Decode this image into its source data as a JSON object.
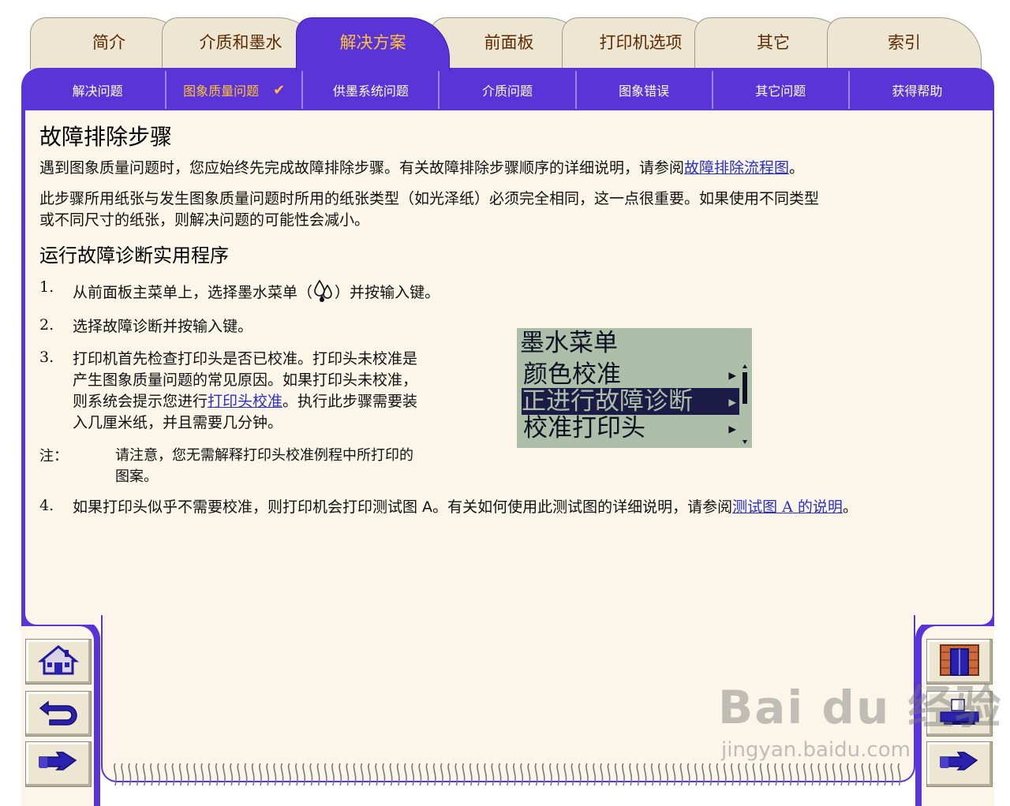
{
  "tabs": [
    {
      "label": "简介",
      "active": false
    },
    {
      "label": "介质和墨水",
      "active": false
    },
    {
      "label": "解决方案",
      "active": true
    },
    {
      "label": "前面板",
      "active": false
    },
    {
      "label": "打印机选项",
      "active": false
    },
    {
      "label": "其它",
      "active": false
    },
    {
      "label": "索引",
      "active": false
    }
  ],
  "subnav": [
    {
      "label": "解决问题",
      "active": false
    },
    {
      "label": "图象质量问题",
      "active": true,
      "check": "✔"
    },
    {
      "label": "供墨系统问题",
      "active": false
    },
    {
      "label": "介质问题",
      "active": false
    },
    {
      "label": "图象错误",
      "active": false
    },
    {
      "label": "其它问题",
      "active": false
    },
    {
      "label": "获得帮助",
      "active": false
    }
  ],
  "content": {
    "title": "故障排除步骤",
    "p1_text": "遇到图象质量问题时，您应始终先完成故障排除步骤。有关故障排除步骤顺序的详细说明，请参阅",
    "p1_link": "故障排除流程图",
    "p1_end": "。",
    "p2_line1": "此步骤所用纸张与发生图象质量问题时所用的纸张类型（如光泽纸）必须完全相同，这一点很重要。如果使用不同类型",
    "p2_line2": "或不同尺寸的纸张，则解决问题的可能性会减小。",
    "h2": "运行故障诊断实用程序",
    "step1": {
      "num": "1.",
      "a": "从前面板主菜单上，选择",
      "b": "墨水菜单",
      "c": "（",
      "d": "）并按",
      "e": "输入",
      "f": "键。"
    },
    "step2": {
      "num": "2.",
      "a": "选择",
      "b": "故障诊断",
      "c": "并按",
      "d": "输入",
      "e": "键。"
    },
    "step3": {
      "num": "3.",
      "line1": "打印机首先检查打印头是否已校准。打印头未校准是",
      "line2": "产生图象质量问题的常见原因。如果打印头未校准，",
      "line3a": "则系统会提示您进行",
      "line3_link": "打印头校准",
      "line3b": "。执行此步骤需要装",
      "line4": "入几厘米纸，并且需要几分钟。"
    },
    "note_label": "注：",
    "note_line1": "请注意，您无需解释打印头校准例程中所打印的",
    "note_line2": "图案。",
    "step4": {
      "num": "4.",
      "a": "如果打印头似乎不需要校准，则打印机会打印",
      "b": "测试图 A",
      "c": "。有关如何使用此测试图的详细说明，请参阅",
      "link": "测试图 A 的说明",
      "d": "。"
    }
  },
  "lcd": {
    "title": "墨水菜单",
    "items": [
      {
        "label": "颜色校准",
        "selected": false
      },
      {
        "label": "正进行故障诊断",
        "selected": true
      },
      {
        "label": "校准打印头",
        "selected": false
      }
    ],
    "arrow": "▶"
  },
  "nav_buttons": {
    "left": [
      "home-icon",
      "back-icon",
      "next-page-icon"
    ],
    "right": [
      "exit-door-icon",
      "print-icon",
      "next-page-icon"
    ]
  },
  "watermark": {
    "logo": "Bai du 经验",
    "url": "jingyan.baidu.com"
  },
  "colors": {
    "frame": "#5a34d6",
    "tab_active_text": "#ffc238",
    "tab_text": "#5e2a00",
    "sheet": "#fbf6e9",
    "link": "#2930c9",
    "lcd_bg": "#aebfa9"
  }
}
